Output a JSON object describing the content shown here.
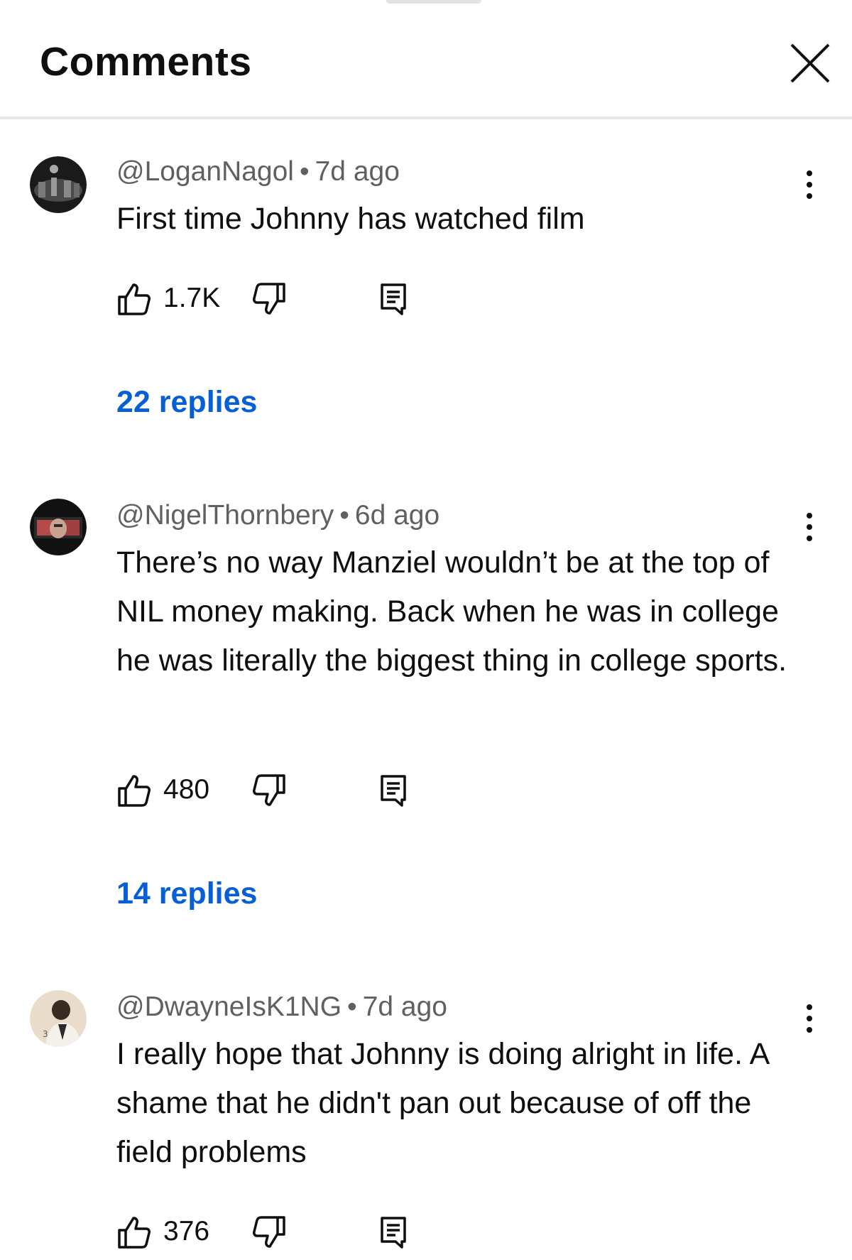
{
  "header": {
    "title": "Comments",
    "close_icon": "close-icon"
  },
  "comments": [
    {
      "author": "@LoganNagol",
      "separator": "•",
      "time": "7d ago",
      "text": "First time Johnny has watched film",
      "likes": "1.7K",
      "replies": "22 replies",
      "avatar_colors": [
        "#1a1a1a",
        "#6a6a6a"
      ]
    },
    {
      "author": "@NigelThornbery",
      "separator": "•",
      "time": "6d ago",
      "text": "There’s no way Manziel wouldn’t be at the top of NIL money making. Back when he was in college he was literally the biggest thing in college sports.",
      "likes": "480",
      "replies": "14 replies",
      "avatar_colors": [
        "#111111",
        "#a83a3a"
      ]
    },
    {
      "author": "@DwayneIsK1NG",
      "separator": "•",
      "time": "7d ago",
      "text": "I really hope that Johnny is doing alright in life. A shame that he didn't pan out because of off the field problems",
      "likes": "376",
      "avatar_colors": [
        "#e8d9c8",
        "#3a2a22"
      ]
    }
  ],
  "icons": {
    "like": "thumbs-up-icon",
    "dislike": "thumbs-down-icon",
    "reply": "reply-icon",
    "more": "more-vertical-icon"
  },
  "colors": {
    "link": "#065fd4",
    "meta": "#606060",
    "text": "#0f0f0f",
    "divider": "#e6e6e6"
  }
}
